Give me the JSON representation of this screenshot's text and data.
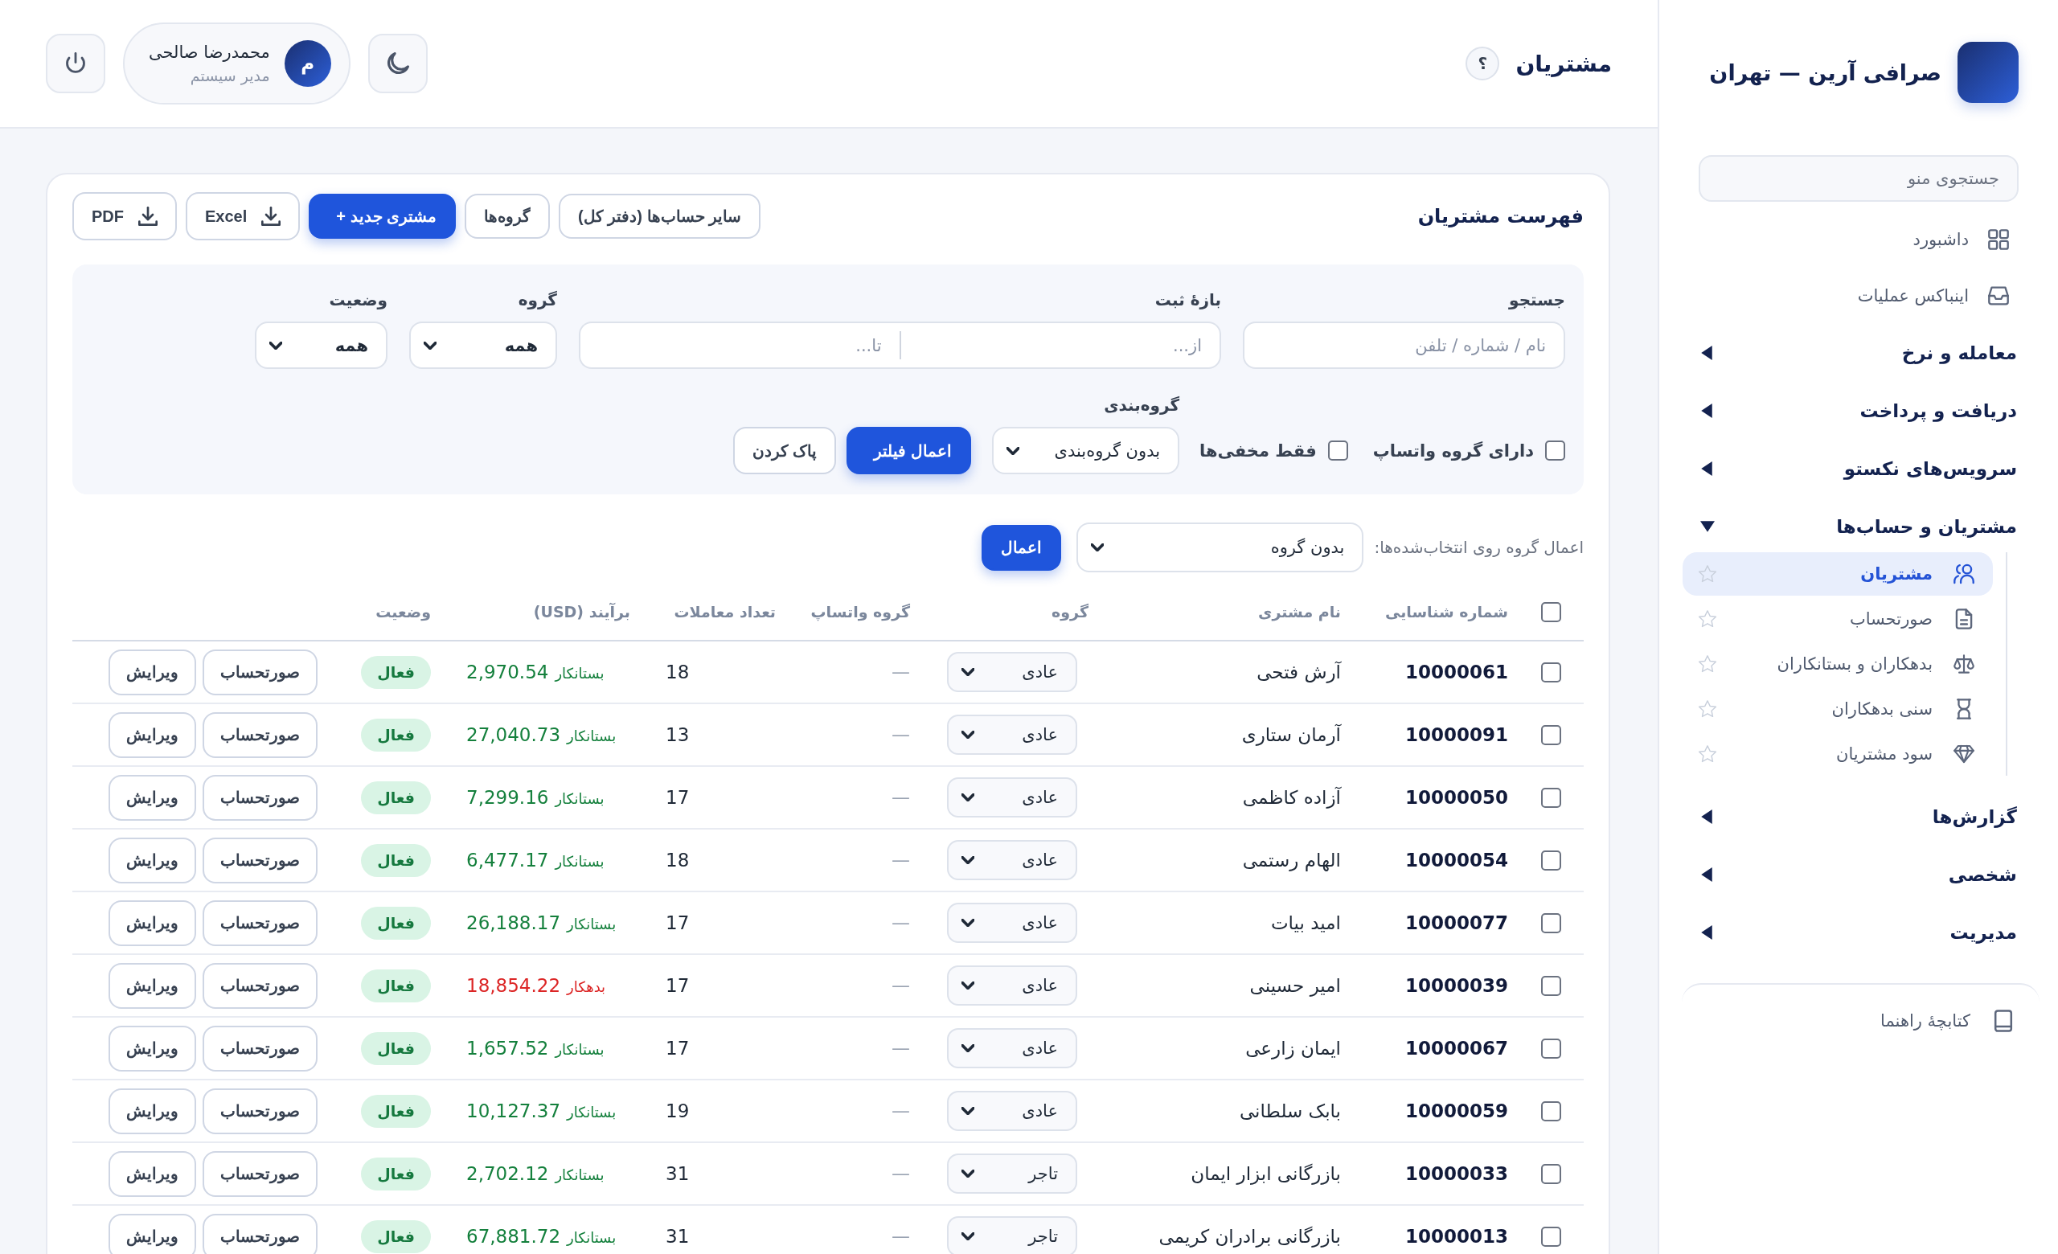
{
  "sidebar": {
    "brand": "صرافی آرین — تهران",
    "search": {
      "placeholder": "جستجوی منو"
    },
    "menu": [
      {
        "kind": "link",
        "label": "داشبورد"
      },
      {
        "kind": "link",
        "label": "اینباکس عملیات"
      },
      {
        "kind": "section",
        "label": "معامله و نرخ",
        "expanded": false
      },
      {
        "kind": "section",
        "label": "دریافت و پرداخت",
        "expanded": false
      },
      {
        "kind": "section",
        "label": "سرویس‌های نکستو",
        "expanded": false
      },
      {
        "kind": "section",
        "label": "مشتریان و حساب‌ها",
        "expanded": true,
        "children": [
          {
            "label": "مشتریان",
            "selected": true,
            "starred": false
          },
          {
            "label": "صورتحساب",
            "selected": false,
            "starred": false
          },
          {
            "label": "بدهکاران و بستانکاران",
            "selected": false,
            "starred": false
          },
          {
            "label": "سنی بدهکاران",
            "selected": false,
            "starred": false
          },
          {
            "label": "سود مشتریان",
            "selected": false,
            "starred": false
          }
        ]
      },
      {
        "kind": "section",
        "label": "گزارش‌ها",
        "expanded": false
      },
      {
        "kind": "section",
        "label": "شخصی",
        "expanded": false
      },
      {
        "kind": "section",
        "label": "مدیریت",
        "expanded": false
      }
    ],
    "footer_link": "کتابچهٔ راهنما"
  },
  "header": {
    "title": "مشتریان",
    "help": "؟",
    "user": {
      "initial": "م",
      "name": "محمدرضا صالحی",
      "role": "مدیر سیستم"
    }
  },
  "customers": {
    "title": "فهرست مشتریان",
    "actions": [
      {
        "kind": "outline",
        "label": "سایر حساب‌ها (دفتر کل)"
      },
      {
        "kind": "outline",
        "label": "گروه‌ها"
      },
      {
        "kind": "primary",
        "label": "+ مشتری جدید"
      },
      {
        "kind": "download",
        "label": "Excel"
      },
      {
        "kind": "download",
        "label": "PDF"
      }
    ],
    "filters": {
      "search": {
        "label": "جستجو",
        "placeholder": "نام / شماره / تلفن"
      },
      "date_range": {
        "label": "بازهٔ ثبت",
        "from": {
          "placeholder": "از..."
        },
        "to": {
          "placeholder": "تا..."
        }
      },
      "group": {
        "label": "گروه",
        "value": "همه"
      },
      "status": {
        "label": "وضعیت",
        "value": "همه"
      },
      "options": [
        {
          "label": "دارای گروه واتساپ",
          "checked": false
        },
        {
          "label": "فقط مخفی‌ها",
          "checked": false
        }
      ],
      "grouping": {
        "label": "گروه‌بندی",
        "value": "بدون گروه‌بندی"
      },
      "buttons": [
        {
          "kind": "primary",
          "label": "اعمال فیلتر"
        },
        {
          "kind": "outline",
          "label": "پاک کردن"
        }
      ]
    },
    "bulk": {
      "label": "اعمال گروه روی انتخاب‌شده‌ها:",
      "value": "بدون گروه",
      "button": "اعمال"
    },
    "table": {
      "all_selected": false,
      "columns": [
        "شماره شناسایی",
        "نام مشتری",
        "گروه",
        "گروه واتساپ",
        "تعداد معاملات",
        "برآیند (USD)",
        "وضعیت"
      ],
      "rows": [
        {
          "selected": false,
          "id": "10000061",
          "name": "آرش فتحی",
          "group": "عادی",
          "whatsapp_group": "—",
          "deals": "18",
          "balance": {
            "amount": "2,970.54",
            "side": "بستانکار",
            "color": "#15803d"
          },
          "status": "فعال",
          "actions": [
            "صورتحساب",
            "ویرایش"
          ]
        },
        {
          "selected": false,
          "id": "10000091",
          "name": "آرمان ستاری",
          "group": "عادی",
          "whatsapp_group": "—",
          "deals": "13",
          "balance": {
            "amount": "27,040.73",
            "side": "بستانکار",
            "color": "#15803d"
          },
          "status": "فعال",
          "actions": [
            "صورتحساب",
            "ویرایش"
          ]
        },
        {
          "selected": false,
          "id": "10000050",
          "name": "آزاده کاظمی",
          "group": "عادی",
          "whatsapp_group": "—",
          "deals": "17",
          "balance": {
            "amount": "7,299.16",
            "side": "بستانکار",
            "color": "#15803d"
          },
          "status": "فعال",
          "actions": [
            "صورتحساب",
            "ویرایش"
          ]
        },
        {
          "selected": false,
          "id": "10000054",
          "name": "الهام رستمی",
          "group": "عادی",
          "whatsapp_group": "—",
          "deals": "18",
          "balance": {
            "amount": "6,477.17",
            "side": "بستانکار",
            "color": "#15803d"
          },
          "status": "فعال",
          "actions": [
            "صورتحساب",
            "ویرایش"
          ]
        },
        {
          "selected": false,
          "id": "10000077",
          "name": "امید بیات",
          "group": "عادی",
          "whatsapp_group": "—",
          "deals": "17",
          "balance": {
            "amount": "26,188.17",
            "side": "بستانکار",
            "color": "#15803d"
          },
          "status": "فعال",
          "actions": [
            "صورتحساب",
            "ویرایش"
          ]
        },
        {
          "selected": false,
          "id": "10000039",
          "name": "امیر حسینی",
          "group": "عادی",
          "whatsapp_group": "—",
          "deals": "17",
          "balance": {
            "amount": "18,854.22",
            "side": "بدهکار",
            "color": "#dc2626"
          },
          "status": "فعال",
          "actions": [
            "صورتحساب",
            "ویرایش"
          ]
        },
        {
          "selected": false,
          "id": "10000067",
          "name": "ایمان زارعی",
          "group": "عادی",
          "whatsapp_group": "—",
          "deals": "17",
          "balance": {
            "amount": "1,657.52",
            "side": "بستانکار",
            "color": "#15803d"
          },
          "status": "فعال",
          "actions": [
            "صورتحساب",
            "ویرایش"
          ]
        },
        {
          "selected": false,
          "id": "10000059",
          "name": "بابک سلطانی",
          "group": "عادی",
          "whatsapp_group": "—",
          "deals": "19",
          "balance": {
            "amount": "10,127.37",
            "side": "بستانکار",
            "color": "#15803d"
          },
          "status": "فعال",
          "actions": [
            "صورتحساب",
            "ویرایش"
          ]
        },
        {
          "selected": false,
          "id": "10000033",
          "name": "بازرگانی ابزار ایمان",
          "group": "تاجر",
          "whatsapp_group": "—",
          "deals": "31",
          "balance": {
            "amount": "2,702.12",
            "side": "بستانکار",
            "color": "#15803d"
          },
          "status": "فعال",
          "actions": [
            "صورتحساب",
            "ویرایش"
          ]
        },
        {
          "selected": false,
          "id": "10000013",
          "name": "بازرگانی برادران کریمی",
          "group": "تاجر",
          "whatsapp_group": "—",
          "deals": "31",
          "balance": {
            "amount": "67,881.72",
            "side": "بستانکار",
            "color": "#15803d"
          },
          "status": "فعال",
          "actions": [
            "صورتحساب",
            "ویرایش"
          ]
        }
      ]
    }
  }
}
